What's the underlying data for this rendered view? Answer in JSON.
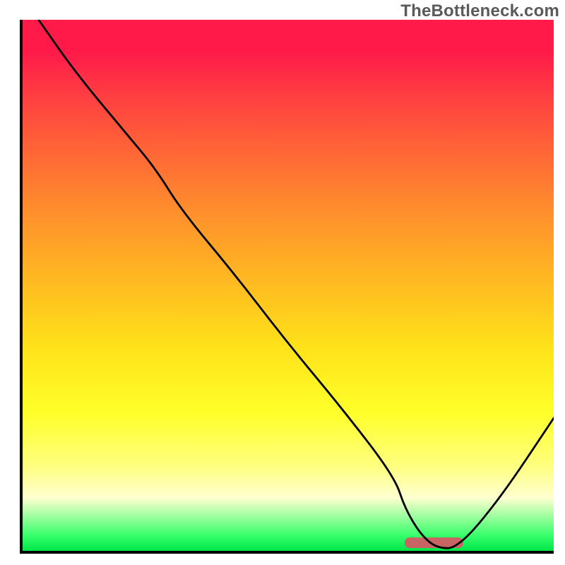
{
  "watermark": "TheBottleneck.com",
  "chart_data": {
    "type": "line",
    "title": "",
    "xlabel": "",
    "ylabel": "",
    "xlim": [
      0,
      100
    ],
    "ylim": [
      0,
      100
    ],
    "grid": false,
    "legend": false,
    "series": [
      {
        "name": "bottleneck-curve",
        "x": [
          3,
          10,
          20,
          25,
          30,
          40,
          50,
          60,
          70,
          72,
          75,
          78,
          82,
          90,
          100
        ],
        "y": [
          100,
          90,
          78,
          72,
          64,
          52,
          39,
          27,
          14,
          8,
          3,
          0.5,
          0.5,
          10,
          25
        ]
      }
    ],
    "marker": {
      "name": "highlight-band",
      "x_start": 72,
      "x_end": 83,
      "y": 1.5,
      "color": "#c86464"
    },
    "background_gradient": {
      "stops": [
        {
          "pos": 0,
          "color": "#ff1a4a"
        },
        {
          "pos": 6,
          "color": "#ff1a4a"
        },
        {
          "pos": 14,
          "color": "#ff3d42"
        },
        {
          "pos": 26,
          "color": "#ff6a35"
        },
        {
          "pos": 36,
          "color": "#ff8e2d"
        },
        {
          "pos": 48,
          "color": "#ffb622"
        },
        {
          "pos": 62,
          "color": "#ffe31a"
        },
        {
          "pos": 74,
          "color": "#ffff2a"
        },
        {
          "pos": 84,
          "color": "#ffff80"
        },
        {
          "pos": 90,
          "color": "#ffffd0"
        },
        {
          "pos": 97,
          "color": "#35ff6a"
        },
        {
          "pos": 100,
          "color": "#00e648"
        }
      ]
    }
  }
}
